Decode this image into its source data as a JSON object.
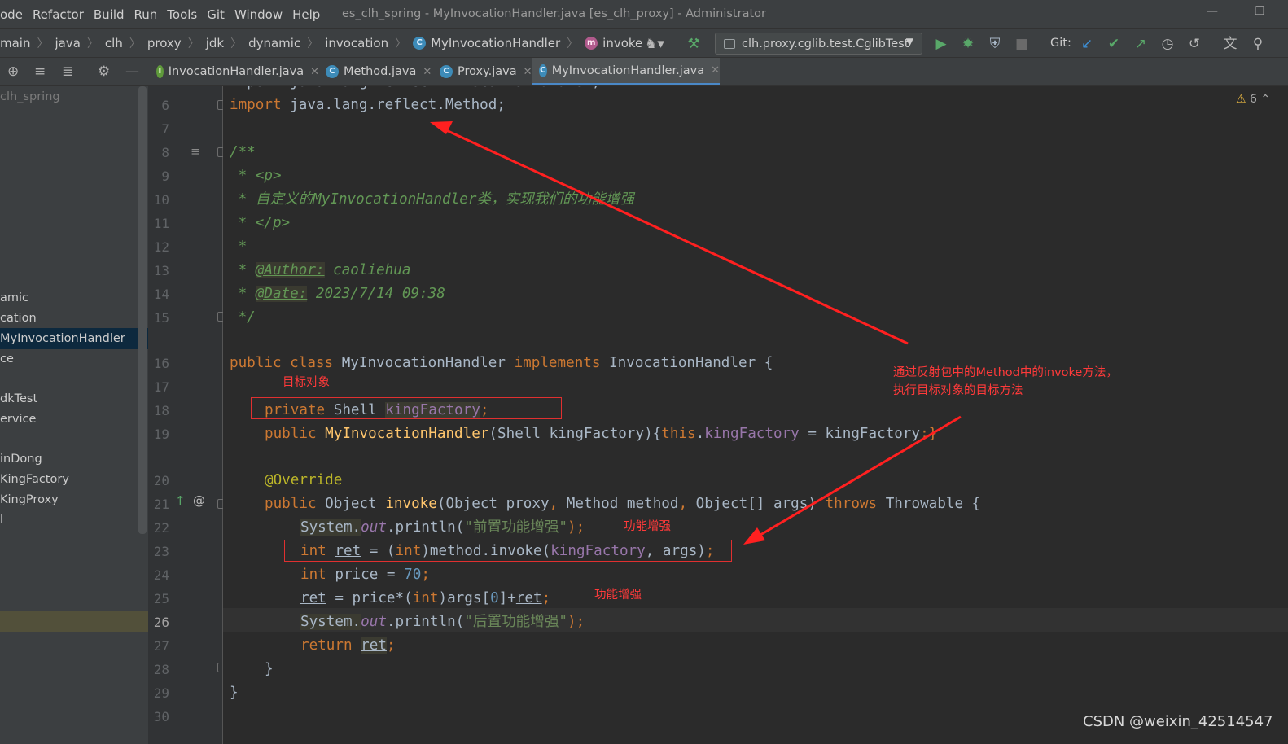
{
  "menubar": {
    "items": [
      "ode",
      "Refactor",
      "Build",
      "Run",
      "Tools",
      "Git",
      "Window",
      "Help"
    ],
    "window_title": "es_clh_spring - MyInvocationHandler.java [es_clh_proxy] - Administrator"
  },
  "navbar": {
    "breadcrumbs": [
      "main",
      "java",
      "clh",
      "proxy",
      "jdk",
      "dynamic",
      "invocation",
      "MyInvocationHandler",
      "invoke"
    ],
    "run_config": "clh.proxy.cglib.test.CglibTest",
    "git_label": "Git:"
  },
  "tabs": [
    {
      "label": "InvocationHandler.java",
      "icon": "interface-icon"
    },
    {
      "label": "Method.java",
      "icon": "class-icon"
    },
    {
      "label": "Proxy.java",
      "icon": "class-icon"
    },
    {
      "label": "MyInvocationHandler.java",
      "icon": "class-icon",
      "active": true
    }
  ],
  "project_tree": {
    "root": "clh_spring",
    "items": [
      "amic",
      "cation",
      "MyInvocationHandler",
      "ce",
      "dkTest",
      "ervice",
      "inDong",
      "KingFactory",
      "KingProxy",
      "l"
    ]
  },
  "editor": {
    "warning_count": "6",
    "line_numbers": [
      "6",
      "7",
      "8",
      "9",
      "10",
      "11",
      "12",
      "13",
      "14",
      "15",
      "16",
      "17",
      "18",
      "19",
      "20",
      "21",
      "22",
      "23",
      "24",
      "25",
      "26",
      "27",
      "28",
      "29",
      "30"
    ],
    "current_line": "26",
    "code": {
      "l6_kw": "import",
      "l6_rest": " java.lang.reflect.Method;",
      "l8": "/**",
      "l9": " * <p>",
      "l10": " * 自定义的MyInvocationHandler类，实现我们的功能增强",
      "l11": " * </p>",
      "l12": " *",
      "l13_pre": " * ",
      "l13_tag": "@Author:",
      "l13_val": " caoliehua",
      "l14_pre": " * ",
      "l14_tag": "@Date:",
      "l14_val": " 2023/7/14 09:38",
      "l15": " */",
      "l16_kw1": "public class ",
      "l16_name": "MyInvocationHandler ",
      "l16_kw2": "implements ",
      "l16_rest": "InvocationHandler {",
      "l18_kw": "private ",
      "l18_type": "Shell ",
      "l18_fld": "kingFactory",
      "l18_end": ";",
      "l19_kw": "public ",
      "l19_fn": "MyInvocationHandler",
      "l19_a": "(Shell kingFactory){",
      "l19_this": "this",
      "l19_dot": ".",
      "l19_fld": "kingFactory",
      "l19_b": " = kingFactory",
      "l19_c": ";}",
      "l20": "@Override",
      "l21_kw": "public ",
      "l21_a": "Object ",
      "l21_fn": "invoke",
      "l21_b": "(Object proxy",
      "l21_c": ", ",
      "l21_d": "Method method",
      "l21_e": ", ",
      "l21_f": "Object[] args) ",
      "l21_kw2": "throws ",
      "l21_g": "Throwable {",
      "l22_sys": "System.",
      "l22_out": "out",
      "l22_a": ".println(",
      "l22_str": "\"前置功能增强\"",
      "l22_b": ");",
      "l23_kw": "int ",
      "l23_ret": "ret",
      "l23_a": " = (",
      "l23_kw2": "int",
      "l23_b": ")method.invoke(",
      "l23_fld": "kingFactory",
      "l23_c": ", args)",
      "l23_d": ";",
      "l24_kw": "int ",
      "l24_a": "price = ",
      "l24_num": "70",
      "l24_b": ";",
      "l25_ret": "ret",
      "l25_a": " = price*(",
      "l25_kw": "int",
      "l25_b": ")args[",
      "l25_num": "0",
      "l25_c": "]+",
      "l25_ret2": "ret",
      "l25_d": ";",
      "l26_sys": "System.",
      "l26_out": "out",
      "l26_a": ".println(",
      "l26_str": "\"后置功能增强\"",
      "l26_b": ");",
      "l27_kw": "return ",
      "l27_ret": "ret",
      "l27_end": ";",
      "l28": "}",
      "l29": "}"
    }
  },
  "annotations": {
    "target_object": "目标对象",
    "enhance_1": "功能增强",
    "enhance_2": "功能增强",
    "explain_line1": "通过反射包中的Method中的invoke方法，",
    "explain_line2": "执行目标对象的目标方法"
  },
  "watermark": "CSDN @weixin_42514547",
  "colors": {
    "annotation_red": "#e03030",
    "keyword": "#cc7832",
    "comment": "#629755",
    "field": "#9876aa",
    "function": "#ffc66d"
  }
}
